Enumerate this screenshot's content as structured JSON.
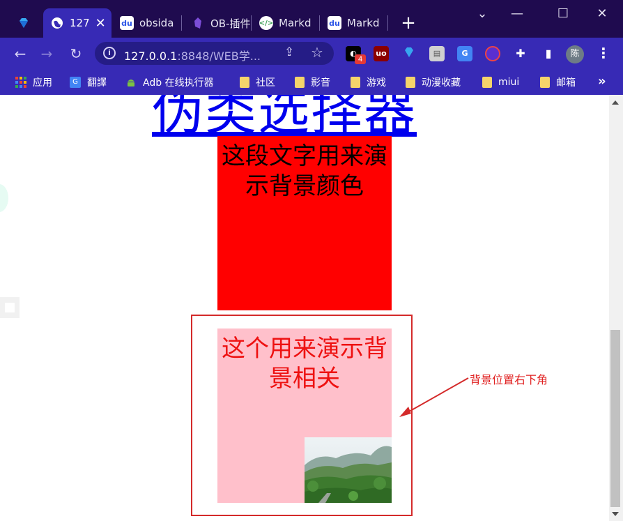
{
  "tabs": [
    {
      "label": "",
      "icon": "gem-icon"
    },
    {
      "label": "127",
      "icon": "globe-icon",
      "active": true
    },
    {
      "label": "obsida",
      "icon": "baidu-paw-icon"
    },
    {
      "label": "OB-插件",
      "icon": "obsidian-gem-icon"
    },
    {
      "label": "Markd",
      "icon": "markdown-icon"
    },
    {
      "label": "Markd",
      "icon": "baidu-paw-icon"
    }
  ],
  "address_bar": {
    "host": "127.0.0.1",
    "path": ":8848/WEB学..."
  },
  "extensions": {
    "badge_count": "4"
  },
  "profile": {
    "avatar_text": "陈"
  },
  "bookmarks": [
    {
      "label": "应用",
      "icon": "apps-grid-icon"
    },
    {
      "label": "翻譯",
      "icon": "google-translate-icon"
    },
    {
      "label": "Adb 在线执行器",
      "icon": "android-icon"
    },
    {
      "label": "社区",
      "icon": "folder-icon"
    },
    {
      "label": "影音",
      "icon": "folder-icon"
    },
    {
      "label": "游戏",
      "icon": "folder-icon"
    },
    {
      "label": "动漫收藏",
      "icon": "folder-icon"
    },
    {
      "label": "miui",
      "icon": "folder-icon"
    },
    {
      "label": "邮箱",
      "icon": "folder-icon"
    }
  ],
  "content": {
    "heading": "伪类选择器",
    "box_red_text": "这段文字用来演示背景颜色",
    "box_pink_text": "这个用来演示背景相关",
    "annotation": "背景位置右下角"
  },
  "colors": {
    "tab_strip": "#1f0b4f",
    "toolbar": "#372ab5",
    "box_red": "#ff0000",
    "box_pink": "#ffc0cb",
    "annotation_red": "#d42a2a",
    "link_blue": "#0000ee"
  }
}
